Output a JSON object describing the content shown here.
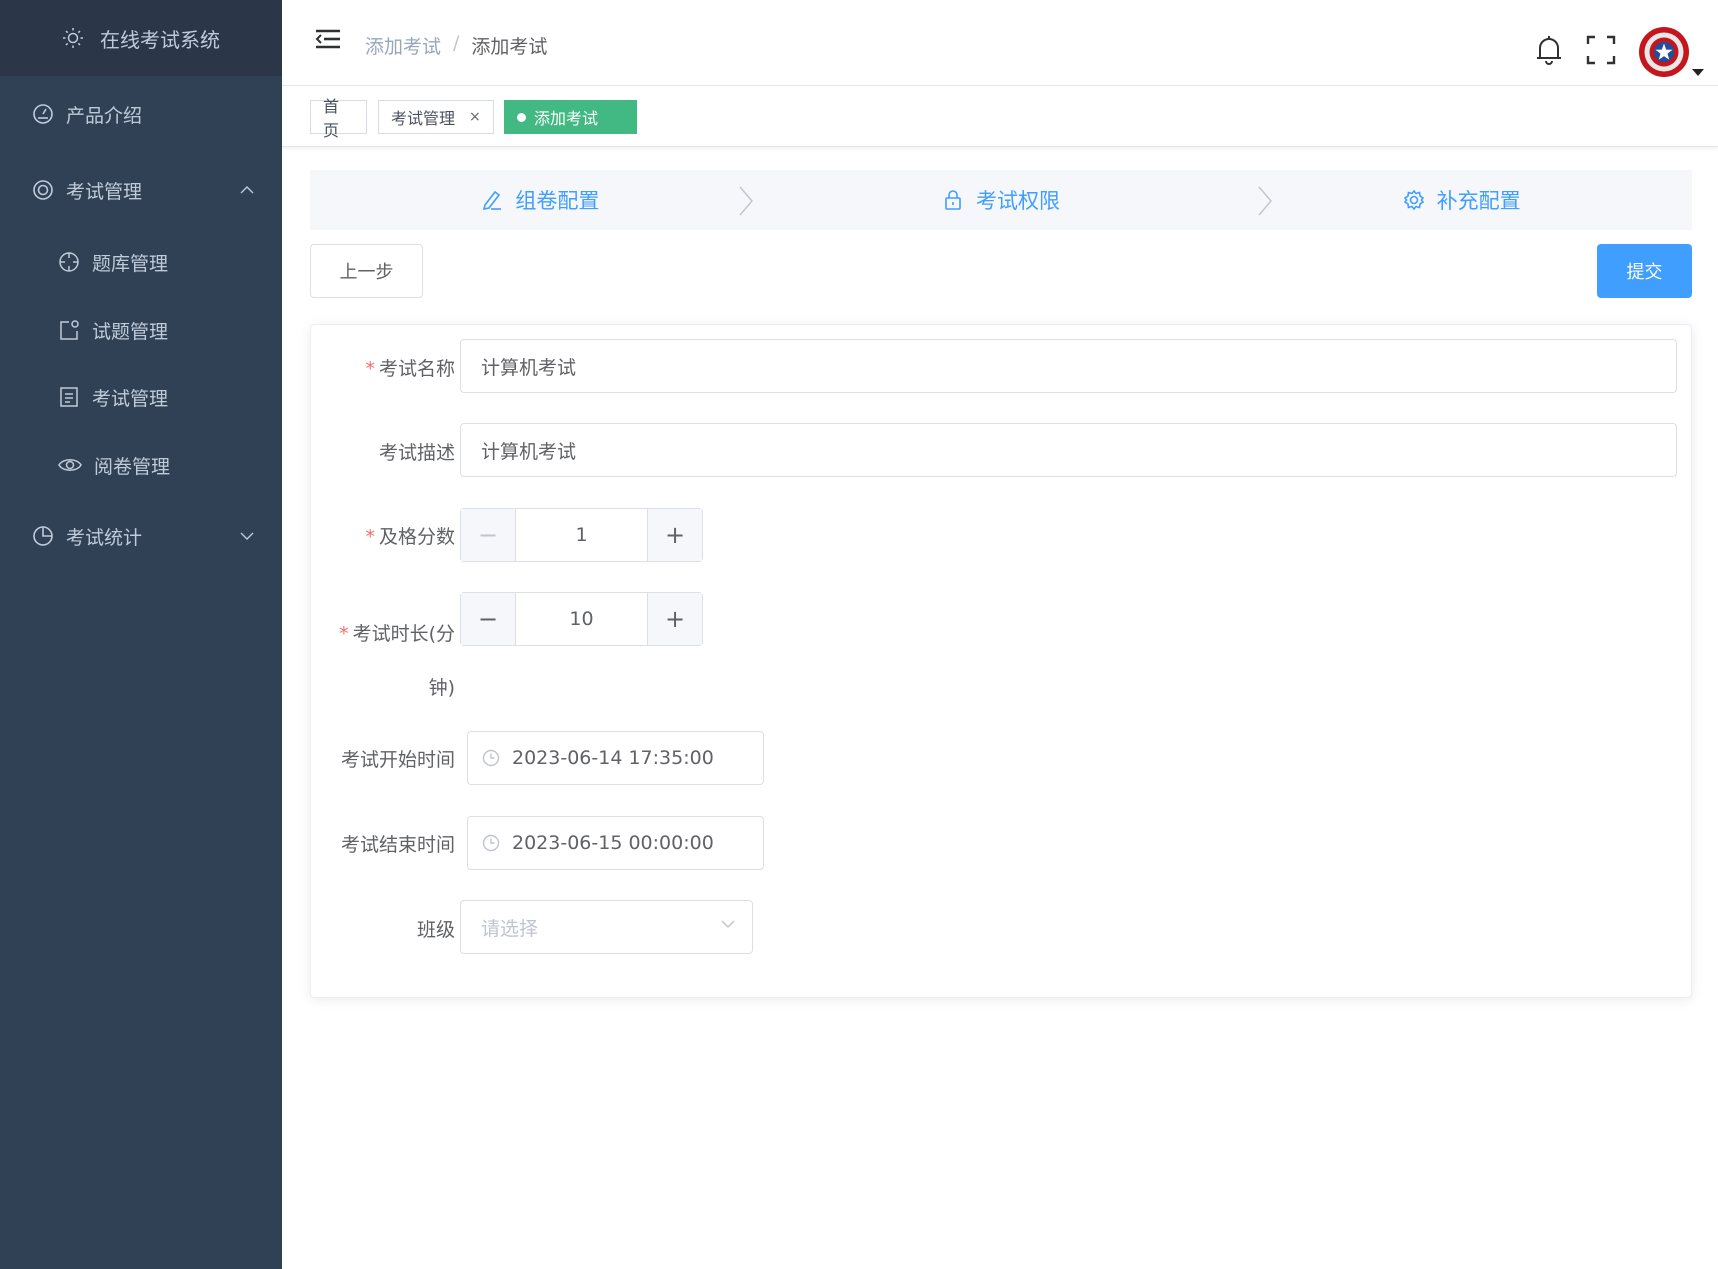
{
  "app": {
    "title": "在线考试系统"
  },
  "sidebar": {
    "items": [
      {
        "label": "产品介绍",
        "icon": "dashboard-icon"
      },
      {
        "label": "考试管理",
        "icon": "lifebuoy-icon"
      },
      {
        "label": "题库管理",
        "icon": "crosshair-icon"
      },
      {
        "label": "试题管理",
        "icon": "edit-square-icon"
      },
      {
        "label": "考试管理",
        "icon": "document-icon"
      },
      {
        "label": "阅卷管理",
        "icon": "eye-icon"
      },
      {
        "label": "考试统计",
        "icon": "pie-chart-icon"
      }
    ]
  },
  "header": {
    "breadcrumb": [
      "添加考试",
      "添加考试"
    ],
    "breadcrumb_sep": "/"
  },
  "tags": [
    {
      "label": "首页"
    },
    {
      "label": "考试管理",
      "close": "×"
    },
    {
      "label": "添加考试",
      "close": "×"
    }
  ],
  "steps": [
    {
      "label": "组卷配置",
      "icon": "edit-pen-icon"
    },
    {
      "label": "考试权限",
      "icon": "lock-icon"
    },
    {
      "label": "补充配置",
      "icon": "gear-icon"
    }
  ],
  "actions": {
    "prev": "上一步",
    "submit": "提交"
  },
  "form": {
    "required_mark": "*",
    "name": {
      "label": "考试名称",
      "value": "计算机考试"
    },
    "desc": {
      "label": "考试描述",
      "value": "计算机考试"
    },
    "pass_score": {
      "label": "及格分数",
      "value": "1",
      "minus": "−",
      "plus": "+"
    },
    "duration": {
      "label_line1": "考试时长(分",
      "label_line2": "钟)",
      "value": "10",
      "minus": "−",
      "plus": "+"
    },
    "start_time": {
      "label": "考试开始时间",
      "value": "2023-06-14 17:35:00"
    },
    "end_time": {
      "label": "考试结束时间",
      "value": "2023-06-15 00:00:00"
    },
    "class": {
      "label": "班级",
      "placeholder": "请选择"
    }
  },
  "colors": {
    "sidebar_bg": "#304156",
    "primary": "#409eff",
    "tag_active": "#42b983",
    "required": "#f56c6c"
  }
}
